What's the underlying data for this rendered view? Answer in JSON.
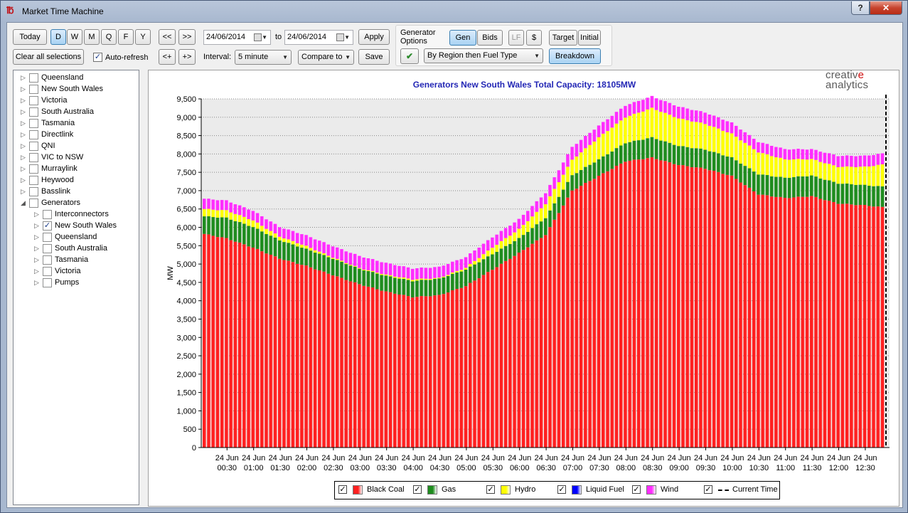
{
  "window": {
    "title": "Market Time Machine",
    "help_label": "?",
    "close_label": "✕"
  },
  "toolbar": {
    "today": "Today",
    "periods": [
      "D",
      "W",
      "M",
      "Q",
      "F",
      "Y"
    ],
    "active_period": "D",
    "prev": "<<",
    "next": ">>",
    "step_back": "<+",
    "step_fwd": "+>",
    "clear_all": "Clear all selections",
    "auto_refresh": "Auto-refresh",
    "auto_refresh_checked": true,
    "date_from": "24/06/2014",
    "to_label": "to",
    "date_to": "24/06/2014",
    "apply": "Apply",
    "interval_label": "Interval:",
    "interval_value": "5 minute",
    "compare_to": "Compare to",
    "save": "Save",
    "gen_options_label_1": "Generator",
    "gen_options_label_2": "Options",
    "gen": "Gen",
    "bids": "Bids",
    "lf": "LF",
    "dollar": "$",
    "target": "Target",
    "initial": "Initial",
    "grouping_value": "By Region then Fuel Type",
    "breakdown": "Breakdown"
  },
  "tree": {
    "items": [
      {
        "label": "Queensland",
        "level": 0,
        "expander": "▷",
        "checked": false
      },
      {
        "label": "New South Wales",
        "level": 0,
        "expander": "▷",
        "checked": false
      },
      {
        "label": "Victoria",
        "level": 0,
        "expander": "▷",
        "checked": false
      },
      {
        "label": "South Australia",
        "level": 0,
        "expander": "▷",
        "checked": false
      },
      {
        "label": "Tasmania",
        "level": 0,
        "expander": "▷",
        "checked": false
      },
      {
        "label": "Directlink",
        "level": 0,
        "expander": "▷",
        "checked": false
      },
      {
        "label": "QNI",
        "level": 0,
        "expander": "▷",
        "checked": false
      },
      {
        "label": "VIC to NSW",
        "level": 0,
        "expander": "▷",
        "checked": false
      },
      {
        "label": "Murraylink",
        "level": 0,
        "expander": "▷",
        "checked": false
      },
      {
        "label": "Heywood",
        "level": 0,
        "expander": "▷",
        "checked": false
      },
      {
        "label": "Basslink",
        "level": 0,
        "expander": "▷",
        "checked": false
      },
      {
        "label": "Generators",
        "level": 0,
        "expander": "◢",
        "checked": false
      },
      {
        "label": "Interconnectors",
        "level": 1,
        "expander": "▷",
        "checked": false
      },
      {
        "label": "New South Wales",
        "level": 1,
        "expander": "▷",
        "checked": true
      },
      {
        "label": "Queensland",
        "level": 1,
        "expander": "▷",
        "checked": false
      },
      {
        "label": "South Australia",
        "level": 1,
        "expander": "▷",
        "checked": false
      },
      {
        "label": "Tasmania",
        "level": 1,
        "expander": "▷",
        "checked": false
      },
      {
        "label": "Victoria",
        "level": 1,
        "expander": "▷",
        "checked": false
      },
      {
        "label": "Pumps",
        "level": 1,
        "expander": "▷",
        "checked": false
      }
    ]
  },
  "brand": {
    "line1_a": "creativ",
    "line1_b": "e",
    "line2": "analytics"
  },
  "legend": [
    {
      "label": "Black Coal",
      "color": "#ff2020",
      "checked": true
    },
    {
      "label": "Gas",
      "color": "#1e8c1e",
      "checked": true
    },
    {
      "label": "Hydro",
      "color": "#ffff00",
      "checked": true
    },
    {
      "label": "Liquid Fuel",
      "color": "#0000ff",
      "checked": true
    },
    {
      "label": "Wind",
      "color": "#ff2cff",
      "checked": true
    },
    {
      "label": "Current Time",
      "color": "#000000",
      "checked": true,
      "dashed": true
    }
  ],
  "chart_data": {
    "type": "bar",
    "stacked": true,
    "title": "Generators New South Wales Total Capacity: 18105MW",
    "ylabel": "MW",
    "xlabel": "",
    "ylim": [
      0,
      9500
    ],
    "yticks": [
      0,
      500,
      1000,
      1500,
      2000,
      2500,
      3000,
      3500,
      4000,
      4500,
      5000,
      5500,
      6000,
      6500,
      7000,
      7500,
      8000,
      8500,
      9000,
      9500
    ],
    "grid": true,
    "x_interval_minutes": 5,
    "xtick_labels": [
      [
        "24 Jun",
        "00:30"
      ],
      [
        "24 Jun",
        "01:00"
      ],
      [
        "24 Jun",
        "01:30"
      ],
      [
        "24 Jun",
        "02:00"
      ],
      [
        "24 Jun",
        "02:30"
      ],
      [
        "24 Jun",
        "03:00"
      ],
      [
        "24 Jun",
        "03:30"
      ],
      [
        "24 Jun",
        "04:00"
      ],
      [
        "24 Jun",
        "04:30"
      ],
      [
        "24 Jun",
        "05:00"
      ],
      [
        "24 Jun",
        "05:30"
      ],
      [
        "24 Jun",
        "06:00"
      ],
      [
        "24 Jun",
        "06:30"
      ],
      [
        "24 Jun",
        "07:00"
      ],
      [
        "24 Jun",
        "07:30"
      ],
      [
        "24 Jun",
        "08:00"
      ],
      [
        "24 Jun",
        "08:30"
      ],
      [
        "24 Jun",
        "09:00"
      ],
      [
        "24 Jun",
        "09:30"
      ],
      [
        "24 Jun",
        "10:00"
      ],
      [
        "24 Jun",
        "10:30"
      ],
      [
        "24 Jun",
        "11:00"
      ],
      [
        "24 Jun",
        "11:30"
      ],
      [
        "24 Jun",
        "12:00"
      ],
      [
        "24 Jun",
        "12:30"
      ]
    ],
    "series_keypoints": {
      "times": [
        "00:05",
        "00:30",
        "01:00",
        "01:30",
        "02:00",
        "02:30",
        "03:00",
        "03:30",
        "04:00",
        "04:30",
        "05:00",
        "05:30",
        "06:00",
        "06:30",
        "07:00",
        "07:30",
        "08:00",
        "08:30",
        "09:00",
        "09:30",
        "10:00",
        "10:30",
        "11:00",
        "11:30",
        "12:00",
        "12:30",
        "12:50"
      ],
      "black_coal": [
        5820,
        5700,
        5450,
        5150,
        4950,
        4700,
        4450,
        4250,
        4100,
        4150,
        4400,
        4850,
        5300,
        5800,
        7000,
        7400,
        7800,
        7900,
        7700,
        7600,
        7400,
        6900,
        6800,
        6850,
        6650,
        6600,
        6550
      ],
      "gas": [
        480,
        560,
        560,
        500,
        460,
        450,
        420,
        430,
        440,
        450,
        450,
        420,
        400,
        460,
        420,
        450,
        500,
        550,
        520,
        520,
        500,
        550,
        550,
        560,
        550,
        550,
        560
      ],
      "hydro": [
        200,
        200,
        180,
        100,
        80,
        30,
        20,
        30,
        40,
        20,
        50,
        180,
        250,
        380,
        420,
        600,
        700,
        800,
        750,
        700,
        650,
        600,
        500,
        450,
        450,
        500,
        600
      ],
      "liquid_fuel": [
        0,
        0,
        0,
        0,
        0,
        0,
        0,
        0,
        0,
        0,
        0,
        0,
        0,
        0,
        0,
        0,
        0,
        0,
        0,
        0,
        0,
        0,
        0,
        0,
        0,
        0,
        0
      ],
      "wind": [
        280,
        270,
        260,
        260,
        290,
        310,
        330,
        320,
        300,
        300,
        290,
        280,
        270,
        300,
        350,
        320,
        320,
        320,
        320,
        310,
        300,
        280,
        280,
        270,
        300,
        300,
        300
      ]
    },
    "current_time": "12:50"
  }
}
